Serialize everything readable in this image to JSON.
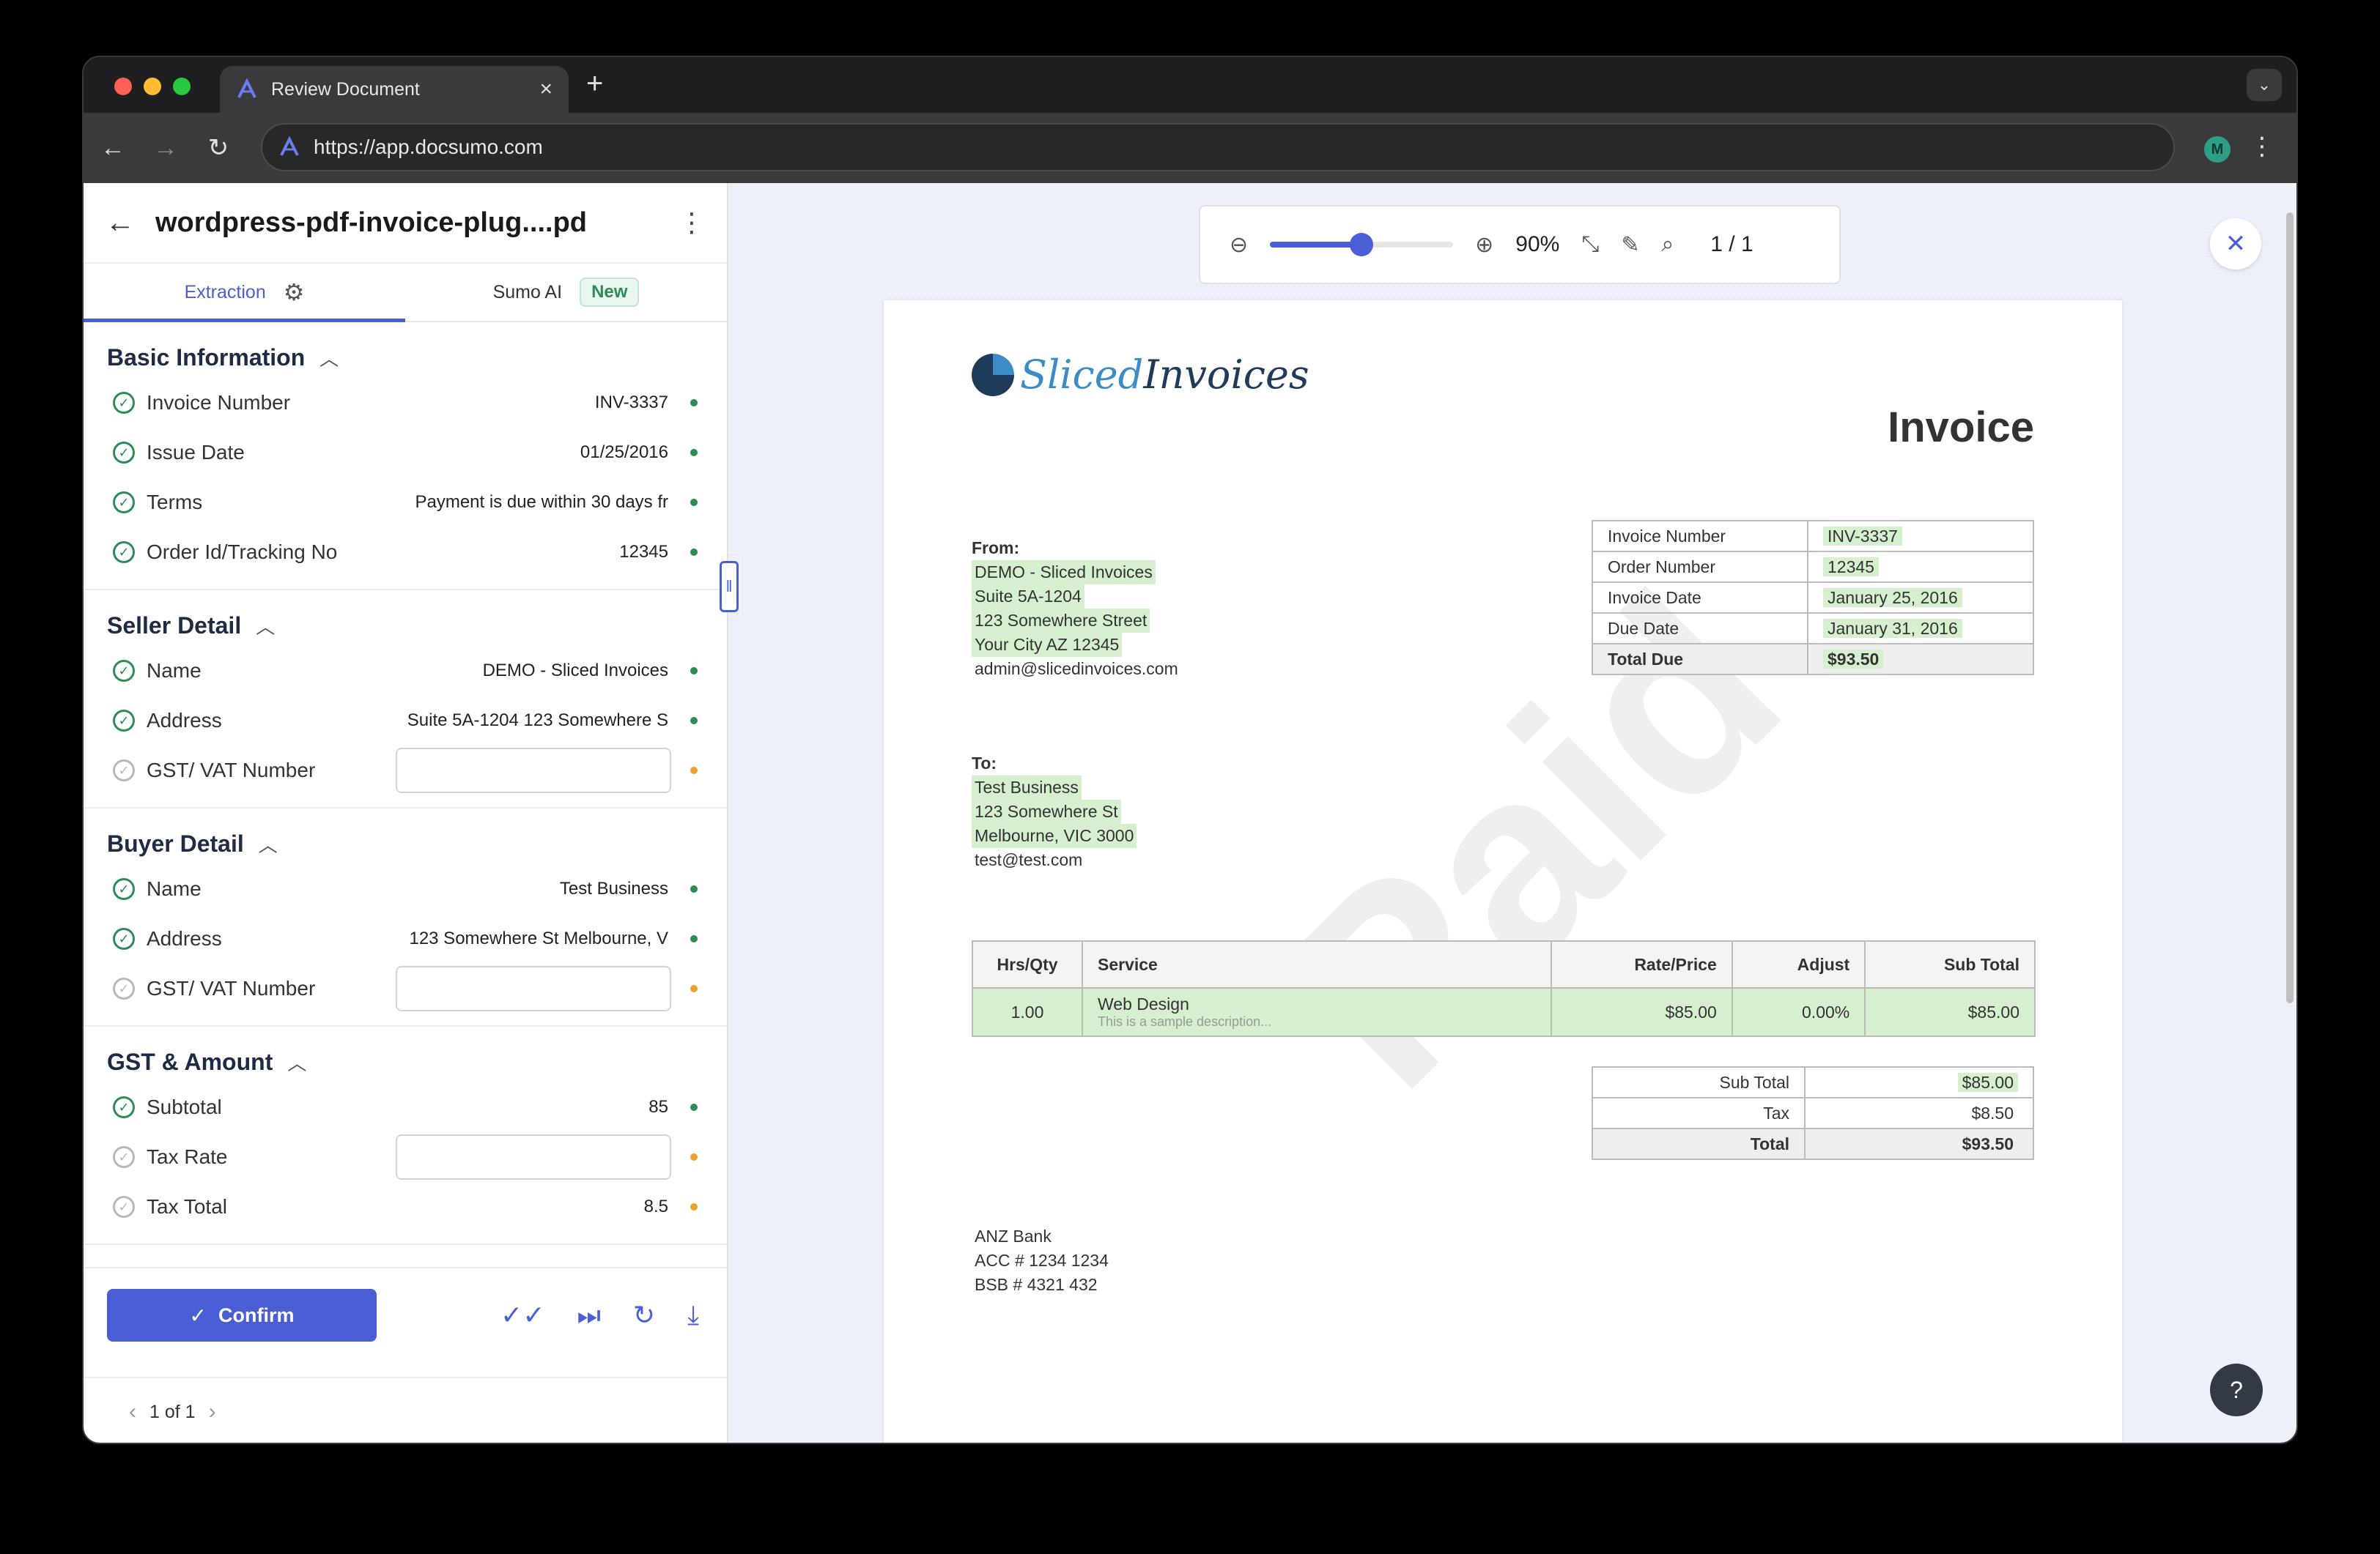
{
  "browser": {
    "tab_title": "Review Document",
    "url": "https://app.docsumo.com",
    "profile_initial": "M"
  },
  "panel": {
    "doc_title": "wordpress-pdf-invoice-plug....pd",
    "tab_extraction": "Extraction",
    "tab_sumo": "Sumo AI",
    "badge_new": "New",
    "sections": [
      {
        "title": "Basic Information",
        "fields": [
          {
            "label": "Invoice Number",
            "value": "INV-3337",
            "status": "green"
          },
          {
            "label": "Issue Date",
            "value": "01/25/2016",
            "status": "green"
          },
          {
            "label": "Terms",
            "value": "Payment is due within 30 days fr",
            "status": "green"
          },
          {
            "label": "Order Id/Tracking No",
            "value": "12345",
            "status": "green"
          }
        ]
      },
      {
        "title": "Seller Detail",
        "fields": [
          {
            "label": "Name",
            "value": "DEMO - Sliced Invoices",
            "status": "green"
          },
          {
            "label": "Address",
            "value": "Suite 5A-1204 123 Somewhere S",
            "status": "green"
          },
          {
            "label": "GST/ VAT Number",
            "value": "",
            "status": "orange"
          }
        ]
      },
      {
        "title": "Buyer Detail",
        "fields": [
          {
            "label": "Name",
            "value": "Test Business",
            "status": "green"
          },
          {
            "label": "Address",
            "value": "123 Somewhere St Melbourne, V",
            "status": "green"
          },
          {
            "label": "GST/ VAT Number",
            "value": "",
            "status": "orange"
          }
        ]
      },
      {
        "title": "GST & Amount",
        "fields": [
          {
            "label": "Subtotal",
            "value": "85",
            "status": "green"
          },
          {
            "label": "Tax Rate",
            "value": "",
            "status": "orange"
          },
          {
            "label": "Tax Total",
            "value": "8.5",
            "status": "orange"
          }
        ]
      }
    ],
    "confirm_label": "Confirm",
    "pager_text": "1 of 1"
  },
  "viewer": {
    "zoom": "90%",
    "zoom_level": 0.5,
    "page_counter": "1 / 1"
  },
  "invoice": {
    "logo_part1": "Sliced",
    "logo_part2": "Invoices",
    "title": "Invoice",
    "from_label": "From:",
    "from_lines": [
      "DEMO - Sliced Invoices",
      "Suite 5A-1204",
      "123 Somewhere Street",
      "Your City AZ 12345",
      "admin@slicedinvoices.com"
    ],
    "to_label": "To:",
    "to_lines": [
      "Test Business",
      "123 Somewhere St",
      "Melbourne, VIC 3000",
      "test@test.com"
    ],
    "meta": [
      {
        "k": "Invoice Number",
        "v": "INV-3337"
      },
      {
        "k": "Order Number",
        "v": "12345"
      },
      {
        "k": "Invoice Date",
        "v": "January 25, 2016"
      },
      {
        "k": "Due Date",
        "v": "January 31, 2016"
      },
      {
        "k": "Total Due",
        "v": "$93.50"
      }
    ],
    "items_headers": [
      "Hrs/Qty",
      "Service",
      "Rate/Price",
      "Adjust",
      "Sub Total"
    ],
    "item": {
      "qty": "1.00",
      "service": "Web Design",
      "desc": "This is a sample description...",
      "rate": "$85.00",
      "adjust": "0.00%",
      "subtotal": "$85.00"
    },
    "totals": [
      {
        "k": "Sub Total",
        "v": "$85.00"
      },
      {
        "k": "Tax",
        "v": "$8.50"
      },
      {
        "k": "Total",
        "v": "$93.50"
      }
    ],
    "bank_lines": [
      "ANZ Bank",
      "ACC # 1234 1234",
      "BSB # 4321 432"
    ],
    "watermark": "Paid"
  }
}
